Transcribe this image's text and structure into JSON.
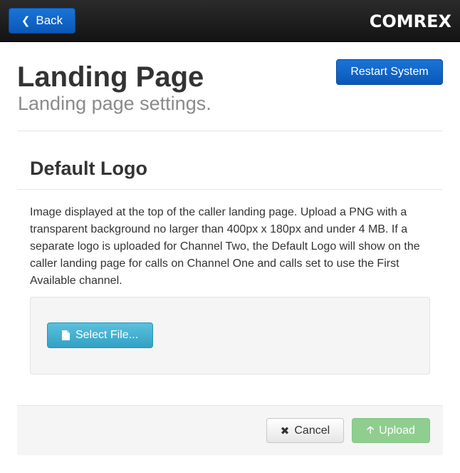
{
  "topbar": {
    "back_label": "Back",
    "logo_text": "COMREX"
  },
  "header": {
    "title": "Landing Page",
    "subtitle": "Landing page settings.",
    "restart_label": "Restart System"
  },
  "section": {
    "title": "Default Logo",
    "description": "Image displayed at the top of the caller landing page. Upload a PNG with a transparent background no larger than 400px x 180px and under 4 MB. If a separate logo is uploaded for Channel Two, the Default Logo will show on the caller landing page for calls on Channel One and calls set to use the First Available channel.",
    "select_file_label": "Select File..."
  },
  "footer": {
    "cancel_label": "Cancel",
    "upload_label": "Upload"
  },
  "icons": {
    "back": "chevron-left-icon",
    "file": "file-icon",
    "cancel": "close-icon",
    "upload": "arrow-up-icon"
  },
  "colors": {
    "primary": "#0a66c8",
    "info": "#40acd0",
    "success_disabled": "#8fce8f",
    "topbar": "#1c1c1c"
  }
}
